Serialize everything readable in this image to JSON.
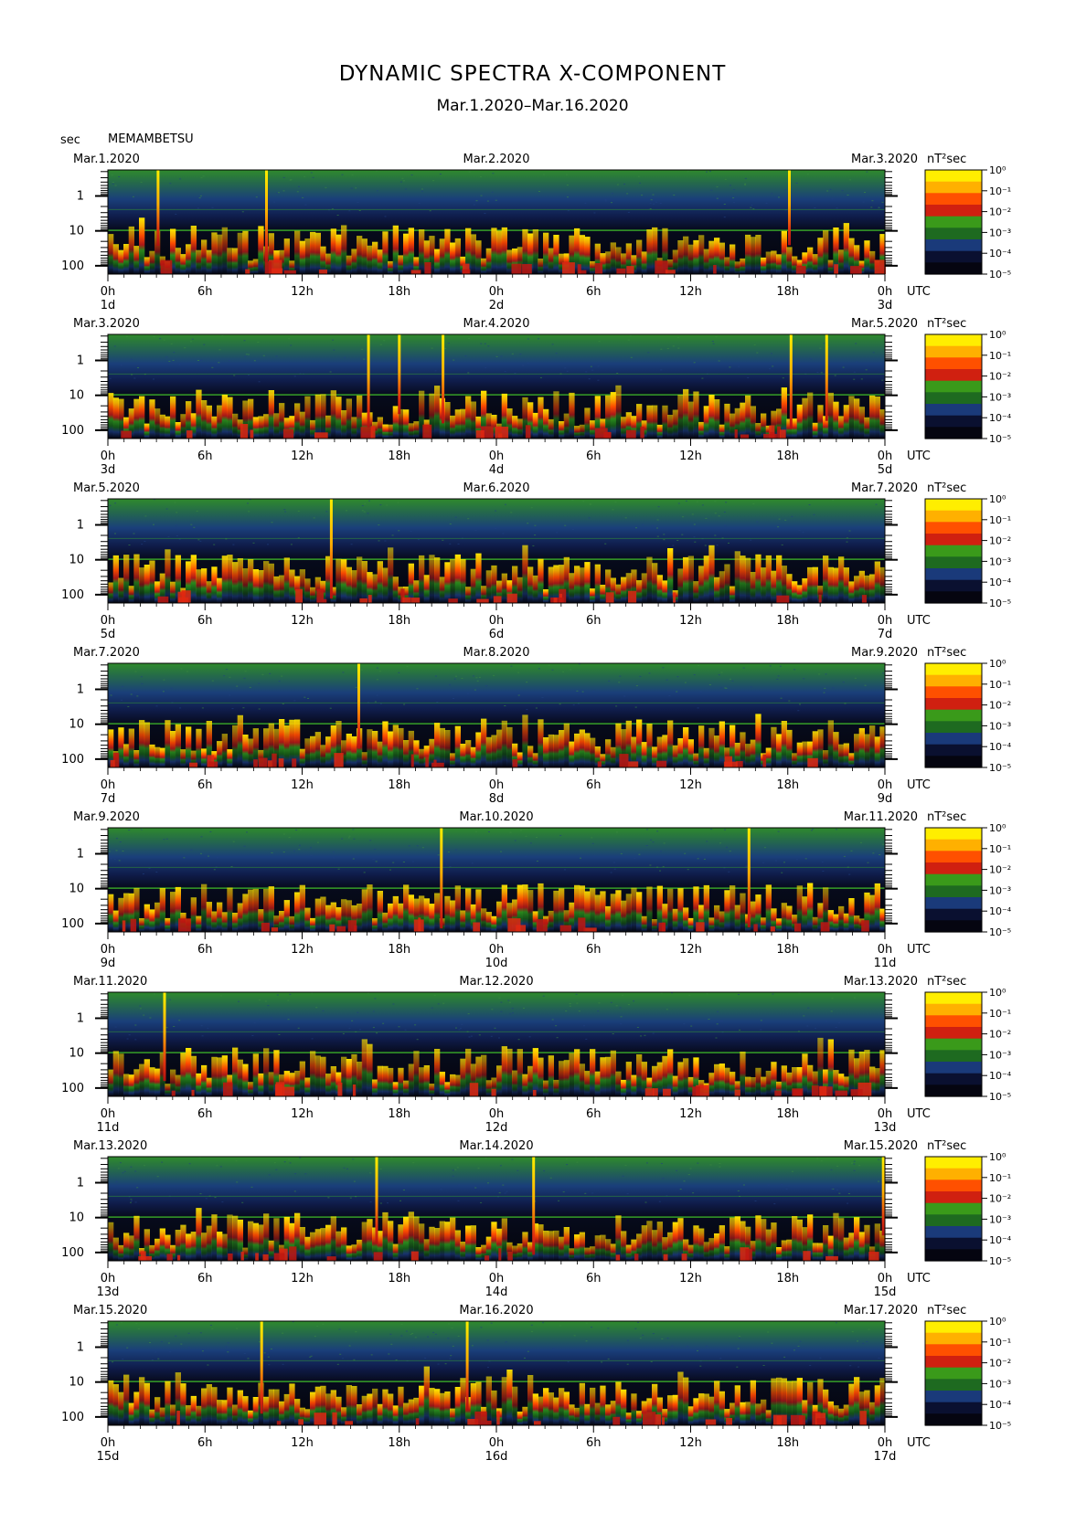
{
  "header": {
    "title": "DYNAMIC SPECTRA X-COMPONENT",
    "subtitle": "Mar.1.2020–Mar.16.2020",
    "unit_left": "sec",
    "station": "MEMAMBETSU"
  },
  "colors": {
    "colormap": [
      "#050510",
      "#0a1030",
      "#1a3a7a",
      "#1e6a20",
      "#3a9a1a",
      "#d02010",
      "#ff5000",
      "#ffb000",
      "#ffee00"
    ],
    "horizontal_line": "#3cb02a"
  },
  "chart_data": {
    "type": "heatmap",
    "component": "X",
    "y_axis": {
      "label": "sec",
      "scale": "log",
      "ticks": [
        "1",
        "10",
        "100"
      ]
    },
    "x_axis": {
      "label": "UTC",
      "ticks": [
        "0h",
        "6h",
        "12h",
        "18h",
        "0h",
        "6h",
        "12h",
        "18h",
        "0h"
      ]
    },
    "colorbar": {
      "unit": "nT²sec",
      "ticks": [
        "10⁰",
        "10⁻¹",
        "10⁻²",
        "10⁻³",
        "10⁻⁴",
        "10⁻⁵"
      ],
      "range_exponent": [
        -5,
        0
      ]
    },
    "panels": [
      {
        "date_left": "Mar.1.2020",
        "date_mid": "Mar.2.2020",
        "date_right": "Mar.3.2020",
        "day_labels": [
          "1d",
          "2d",
          "3d"
        ],
        "spikes_hours": [
          3.1,
          9.8,
          42.1
        ]
      },
      {
        "date_left": "Mar.3.2020",
        "date_mid": "Mar.4.2020",
        "date_right": "Mar.5.2020",
        "day_labels": [
          "3d",
          "4d",
          "5d"
        ],
        "spikes_hours": [
          16.1,
          18.0,
          20.7,
          42.2,
          44.4
        ]
      },
      {
        "date_left": "Mar.5.2020",
        "date_mid": "Mar.6.2020",
        "date_right": "Mar.7.2020",
        "day_labels": [
          "5d",
          "6d",
          "7d"
        ],
        "spikes_hours": [
          13.8
        ]
      },
      {
        "date_left": "Mar.7.2020",
        "date_mid": "Mar.8.2020",
        "date_right": "Mar.9.2020",
        "day_labels": [
          "7d",
          "8d",
          "9d"
        ],
        "spikes_hours": [
          15.5
        ]
      },
      {
        "date_left": "Mar.9.2020",
        "date_mid": "Mar.10.2020",
        "date_right": "Mar.11.2020",
        "day_labels": [
          "9d",
          "10d",
          "11d"
        ],
        "spikes_hours": [
          20.6,
          39.6
        ]
      },
      {
        "date_left": "Mar.11.2020",
        "date_mid": "Mar.12.2020",
        "date_right": "Mar.13.2020",
        "day_labels": [
          "11d",
          "12d",
          "13d"
        ],
        "spikes_hours": [
          3.5
        ]
      },
      {
        "date_left": "Mar.13.2020",
        "date_mid": "Mar.14.2020",
        "date_right": "Mar.15.2020",
        "day_labels": [
          "13d",
          "14d",
          "15d"
        ],
        "spikes_hours": [
          16.6,
          26.3,
          47.9
        ]
      },
      {
        "date_left": "Mar.15.2020",
        "date_mid": "Mar.16.2020",
        "date_right": "Mar.17.2020",
        "day_labels": [
          "15d",
          "16d",
          "17d"
        ],
        "spikes_hours": [
          9.5,
          22.2
        ]
      }
    ]
  }
}
